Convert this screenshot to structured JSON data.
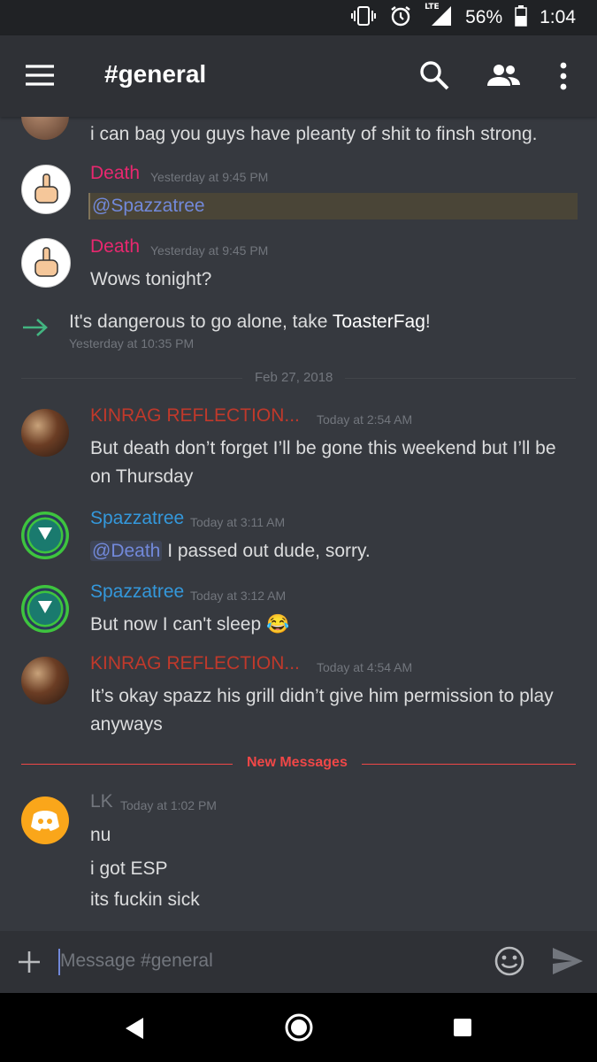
{
  "status_bar": {
    "battery": "56%",
    "time": "1:04",
    "network": "LTE"
  },
  "app_bar": {
    "channel_title": "#general"
  },
  "messages": [
    {
      "text": "i can bag you guys have pleanty of shit to finsh strong."
    },
    {
      "author": "Death",
      "timestamp": "Yesterday at 9:45 PM",
      "mention": "@Spazzatree"
    },
    {
      "author": "Death",
      "timestamp": "Yesterday at 9:45 PM",
      "text": "Wows tonight?"
    },
    {
      "system_prefix": "It's dangerous to go alone, take ",
      "system_name": "ToasterFag",
      "system_suffix": "!",
      "timestamp": "Yesterday at 10:35 PM"
    },
    {
      "date_divider": "Feb 27, 2018"
    },
    {
      "author": "KINRAG REFLECTION...",
      "timestamp": "Today at 2:54 AM",
      "text": "But death don’t forget I’ll be gone this weekend but I’ll be on Thursday"
    },
    {
      "author": "Spazzatree",
      "timestamp": "Today at 3:11 AM",
      "mention": "@Death",
      "text": " I passed out dude, sorry."
    },
    {
      "author": "Spazzatree",
      "timestamp": "Today at 3:12 AM",
      "text": "But now I can't sleep 😂"
    },
    {
      "author": "KINRAG REFLECTION...",
      "timestamp": "Today at 4:54 AM",
      "text": "It’s okay spazz his grill didn’t give him permission to play anyways"
    },
    {
      "new_messages_label": "New Messages"
    },
    {
      "author": "LK",
      "timestamp": "Today at 1:02 PM",
      "lines": [
        "nu",
        "i got ESP",
        "its fuckin sick"
      ]
    }
  ],
  "composer": {
    "placeholder": "Message #general"
  },
  "colors": {
    "death": "#e8286f",
    "kinrag": "#c0392b",
    "spazzatree": "#3498db",
    "lk": "#72767d",
    "mention": "#7289da",
    "new_messages": "#f04747"
  }
}
